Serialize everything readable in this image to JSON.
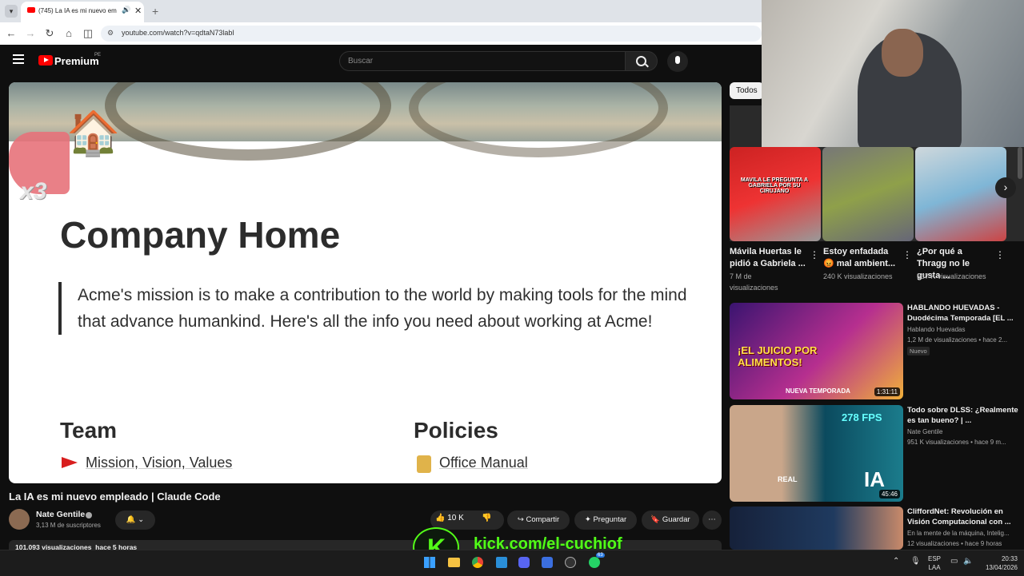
{
  "browser": {
    "tab_title": "(745) La IA es mi nuevo em",
    "url": "youtube.com/watch?v=qdtaN73labI"
  },
  "youtube": {
    "brand": "Premium",
    "region": "PE",
    "search_placeholder": "Buscar",
    "video": {
      "page_title": "Company Home",
      "quote": "Acme's mission is to make a contribution to the world by making tools for the mind that advance humankind. Here's all the info you need about working at Acme!",
      "team_heading": "Team",
      "team_link": "Mission, Vision, Values",
      "policies_heading": "Policies",
      "policies_link": "Office Manual",
      "overlay_text": "x3"
    },
    "title": "La IA es mi nuevo empleado | Claude Code",
    "channel": "Nate Gentile",
    "subscribers": "3,13 M de suscriptores",
    "views_line": "101.093 visualizaciones  hace 5 horas",
    "actions": {
      "likes": "10 K",
      "share": "Compartir",
      "ask": "Preguntar",
      "save": "Guardar"
    },
    "chips": [
      "Todos"
    ],
    "shorts": [
      {
        "title": "Mávila Huertas le pidió a Gabriela ...",
        "meta": "7 M de visualizaciones",
        "thumb_text": "MAVILA LE PREGUNTA A GABRIELA POR SU CIRUJANO"
      },
      {
        "title": "Estoy enfadada 😡 mal ambient...",
        "meta": "240 K visualizaciones"
      },
      {
        "title": "¿Por qué a Thragg no le gusta ...",
        "meta": "537 K visualizaciones"
      }
    ],
    "recommended": [
      {
        "title": "HABLANDO HUEVADAS - Duodécima Temporada [EL ...",
        "channel": "Hablando Huevadas",
        "meta": "1,2 M de visualizaciones • hace 2...",
        "badge": "Nuevo",
        "duration": "1:31:11",
        "thumb_text": "¡EL JUICIO POR ALIMENTOS!",
        "thumb_sub": "NUEVA TEMPORADA"
      },
      {
        "title": "Todo sobre DLSS: ¿Realmente es tan bueno? | ...",
        "channel": "Nate Gentile",
        "meta": "951 K visualizaciones • hace 9 m...",
        "duration": "45:46",
        "thumb_text": "IA",
        "thumb_fps": "278 FPS",
        "thumb_real": "REAL"
      },
      {
        "title": "CliffordNet: Revolución en Visión Computacional con ...",
        "channel": "En la mente de la máquina, Intelig...",
        "meta": "12 visualizaciones • hace 9 horas"
      }
    ]
  },
  "stream": {
    "kick_url": "kick.com/el-cuchiof",
    "kick_letter": "K"
  },
  "taskbar": {
    "lang": "ESP",
    "lang2": "LAA",
    "time": "20:33",
    "date": "13/04/2026",
    "badge": "63"
  }
}
